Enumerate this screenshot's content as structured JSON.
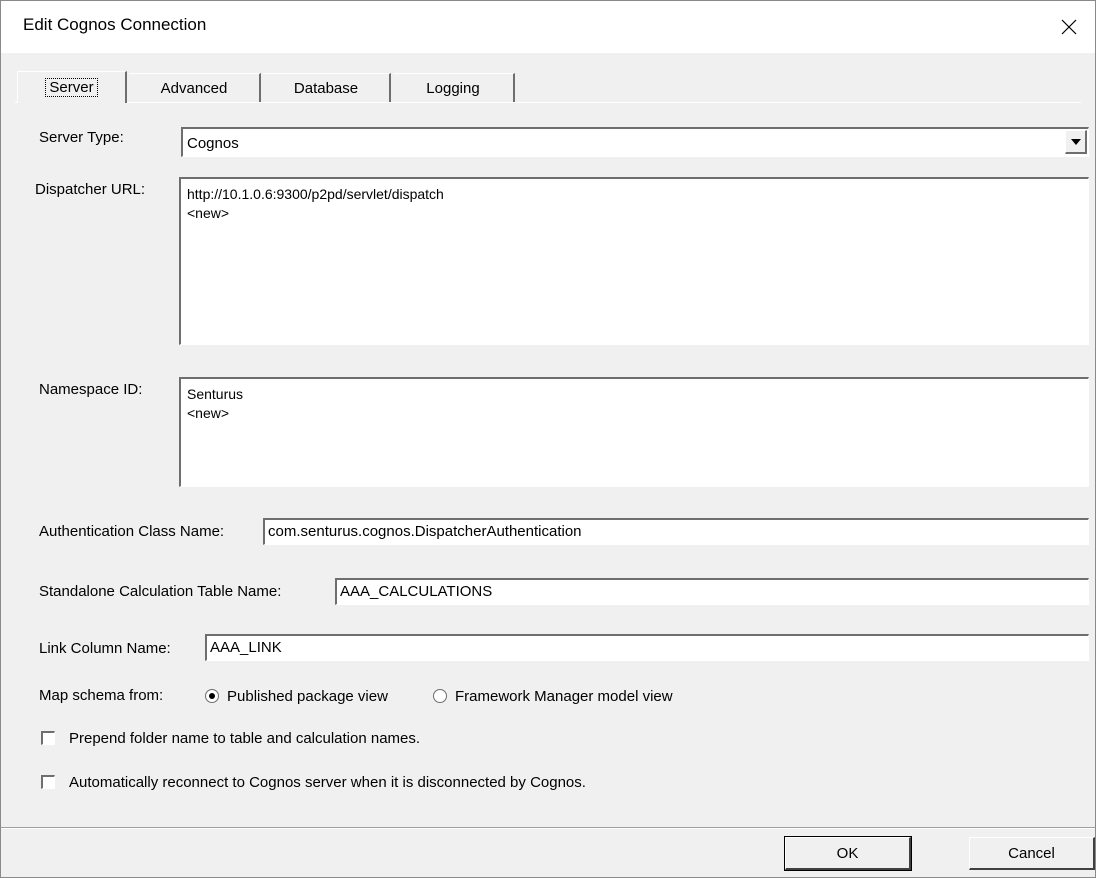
{
  "window": {
    "title": "Edit Cognos Connection"
  },
  "tabs": [
    {
      "label": "Server"
    },
    {
      "label": "Advanced"
    },
    {
      "label": "Database"
    },
    {
      "label": "Logging"
    }
  ],
  "server": {
    "server_type_label": "Server Type:",
    "server_type_value": "Cognos",
    "dispatcher_url_label": "Dispatcher URL:",
    "dispatcher_urls": [
      "http://10.1.0.6:9300/p2pd/servlet/dispatch",
      "<new>"
    ],
    "namespace_id_label": "Namespace ID:",
    "namespace_ids": [
      "Senturus",
      "<new>"
    ],
    "auth_class_label": "Authentication Class Name:",
    "auth_class_value": "com.senturus.cognos.DispatcherAuthentication",
    "calc_table_label": "Standalone Calculation Table Name:",
    "calc_table_value": "AAA_CALCULATIONS",
    "link_column_label": "Link Column Name:",
    "link_column_value": "AAA_LINK",
    "map_schema_label": "Map schema from:",
    "map_schema_options": [
      "Published package view",
      "Framework Manager model view"
    ],
    "map_schema_selected": "Published package view",
    "prepend_folder_label": "Prepend folder name to table and calculation names.",
    "prepend_folder_checked": false,
    "auto_reconnect_label": "Automatically reconnect to Cognos server when it is disconnected by Cognos.",
    "auto_reconnect_checked": false
  },
  "buttons": {
    "ok": "OK",
    "cancel": "Cancel"
  },
  "icons": {
    "close": "close-icon",
    "dropdown": "chevron-down-icon"
  }
}
